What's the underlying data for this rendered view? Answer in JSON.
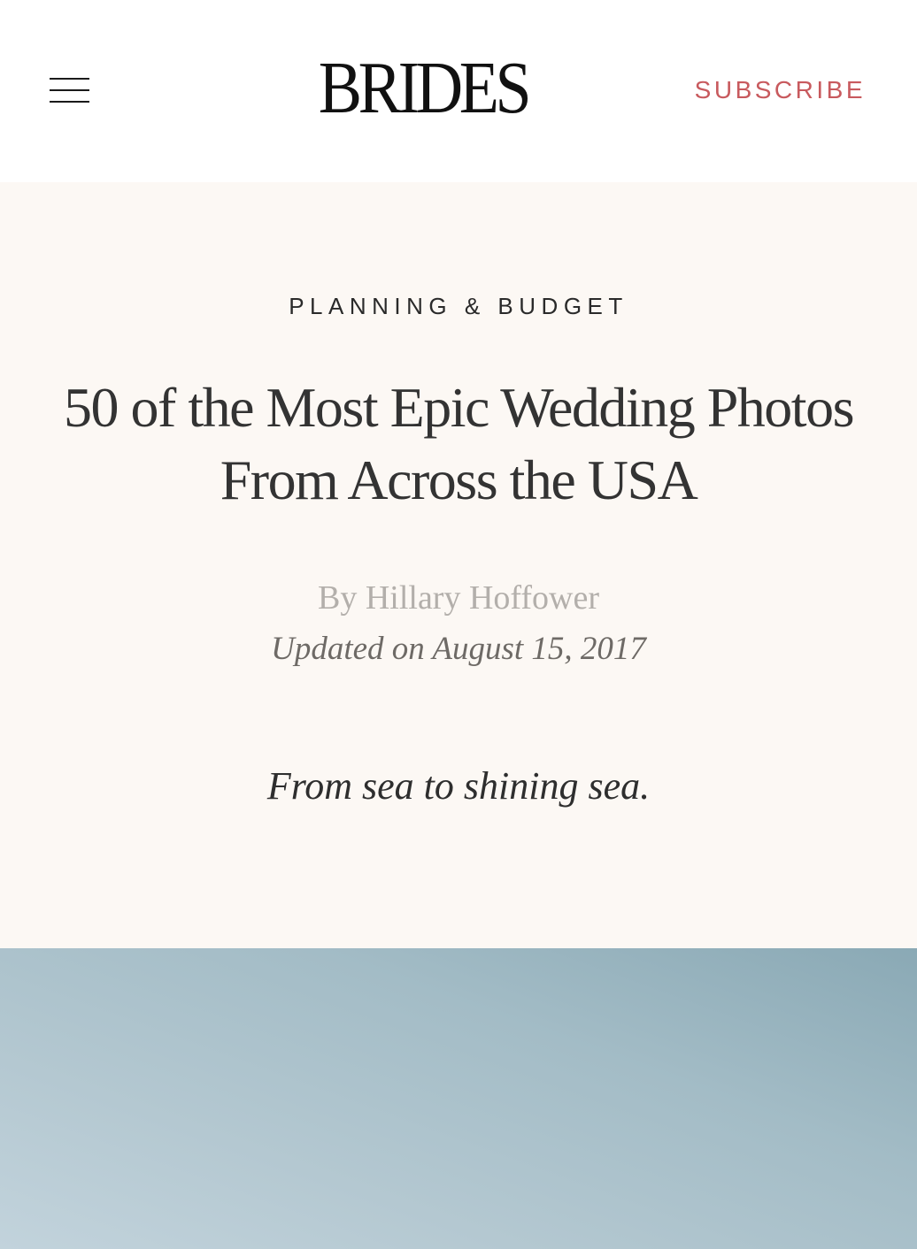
{
  "header": {
    "logo": "BRIDES",
    "subscribe_label": "SUBSCRIBE",
    "menu_icon": "hamburger-menu-icon"
  },
  "article": {
    "category": "PLANNING & BUDGET",
    "title": "50 of the Most Epic Wedding Photos From Across the USA",
    "byline": "By Hillary Hoffower",
    "updated": "Updated on August 15, 2017",
    "dek": "From sea to shining sea."
  },
  "colors": {
    "accent": "#c85a5e",
    "hero_background": "#fcf8f4",
    "sky_top": "#8aa9b5",
    "sky_bottom": "#c2d3dc"
  }
}
